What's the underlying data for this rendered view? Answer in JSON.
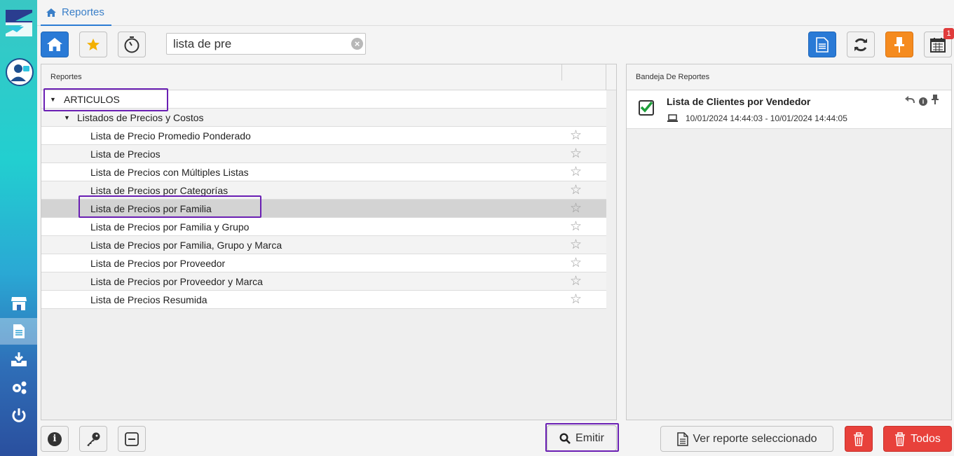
{
  "tab": {
    "label": "Reportes"
  },
  "search": {
    "value": "lista de pre",
    "clear_icon": "clear-icon"
  },
  "notification_count": "1",
  "left_panel": {
    "header": "Reportes"
  },
  "tree": {
    "root": "ARTICULOS",
    "group": "Listados de Precios y Costos",
    "items": [
      "Lista de Precio Promedio Ponderado",
      "Lista de Precios",
      "Lista de Precios con Múltiples Listas",
      "Lista de Precios por Categorías",
      "Lista de Precios por Familia",
      "Lista de Precios por Familia y Grupo",
      "Lista de Precios por Familia, Grupo y Marca",
      "Lista de Precios por Proveedor",
      "Lista de Precios por Proveedor y Marca",
      "Lista de Precios Resumida"
    ],
    "selected_index": 4
  },
  "right_panel": {
    "header": "Bandeja De Reportes",
    "item": {
      "title": "Lista de Clientes por Vendedor",
      "subtitle": "10/01/2024 14:44:03 - 10/01/2024 14:44:05"
    }
  },
  "bottom": {
    "emit_label": "Emitir",
    "view_label": "Ver reporte seleccionado",
    "all_label": "Todos"
  },
  "colors": {
    "accent": "#2a7ad6",
    "highlight": "#6a1fb3",
    "danger": "#e8413b",
    "pin": "#f58b1f"
  }
}
